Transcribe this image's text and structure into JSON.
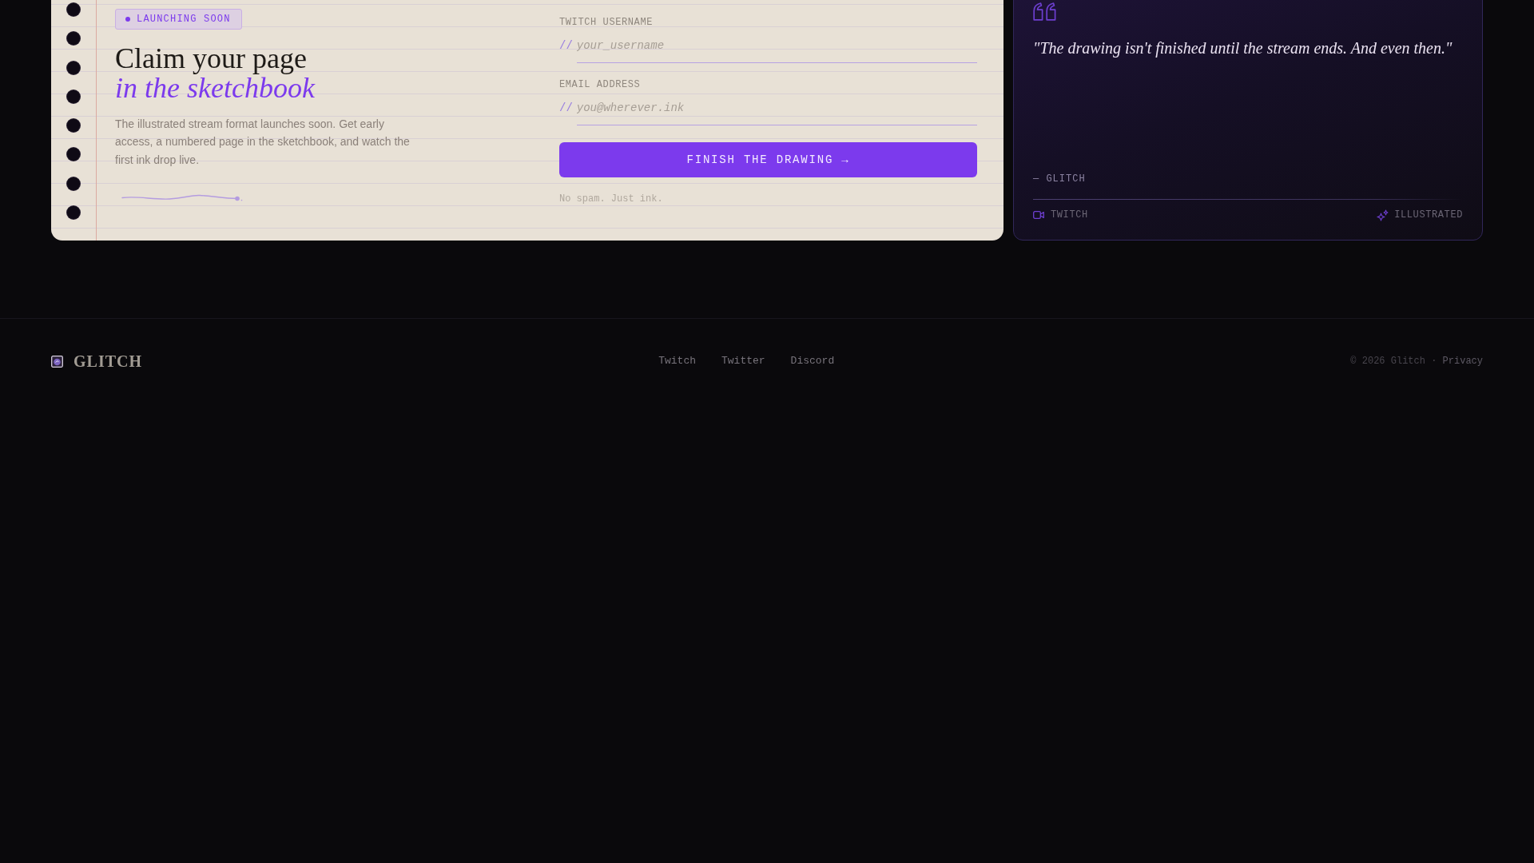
{
  "signup_card": {
    "badge": {
      "label": "LAUNCHING SOON"
    },
    "heading": {
      "line_1": "Claim your page",
      "line_2": "in the sketchbook"
    },
    "description": "The illustrated stream format launches soon. Get early access, a numbered page in the sketchbook, and watch the first ink drop live.",
    "form": {
      "fields": [
        {
          "label": "TWITCH USERNAME",
          "prefix": "//",
          "placeholder": "your_username"
        },
        {
          "label": "EMAIL ADDRESS",
          "prefix": "//",
          "placeholder": "you@wherever.ink"
        }
      ],
      "submit_button": "FINISH THE DRAWING →",
      "note": "No spam. Just ink."
    }
  },
  "quote_card": {
    "quote": "\"The drawing isn't finished until the stream ends. And even then.\"",
    "attribution": "— GLITCH",
    "source_tag": "TWITCH",
    "style_tag": "ILLUSTRATED"
  },
  "footer": {
    "brand": "GLITCH",
    "links": [
      "Twitch",
      "Twitter",
      "Discord"
    ],
    "copyright": "© 2026 Glitch ·",
    "privacy_link": "Privacy"
  }
}
